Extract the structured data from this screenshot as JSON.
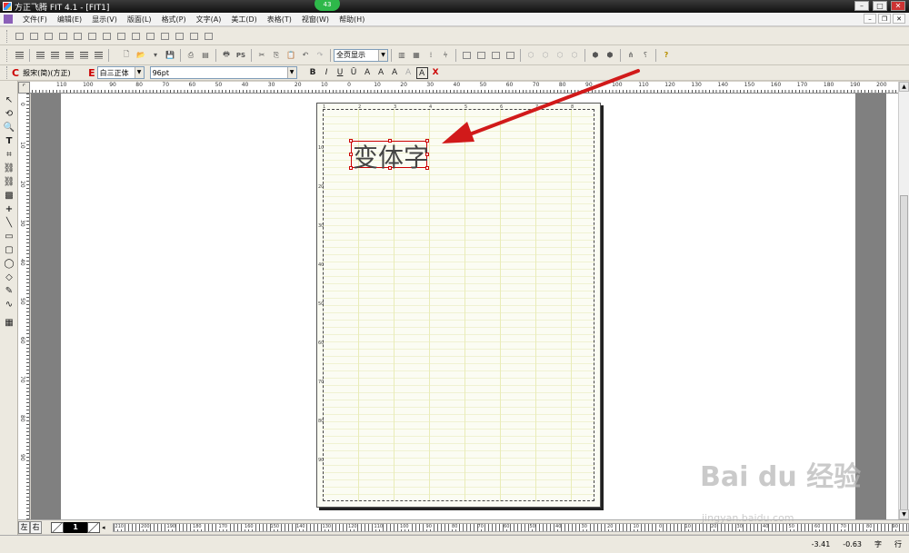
{
  "window": {
    "title": "方正飞腾 FIT 4.1 - [FIT1]",
    "badge": "43"
  },
  "menu": [
    "文件(F)",
    "编辑(E)",
    "显示(V)",
    "版面(L)",
    "格式(P)",
    "文字(A)",
    "美工(D)",
    "表格(T)",
    "视窗(W)",
    "帮助(H)"
  ],
  "toolbar": {
    "zoom_select": "全页显示",
    "font_c_label": "C",
    "font_c_value": "报宋(简)(方正)",
    "font_e_label": "E",
    "font_e_value": "白三正体",
    "font_size": "96pt",
    "fmt_buttons": [
      "B",
      "I",
      "U",
      "Ū",
      "A",
      "A",
      "A",
      "A",
      "A",
      "X"
    ]
  },
  "ruler": {
    "h_labels": [
      "110",
      "100",
      "90",
      "80",
      "70",
      "60",
      "50",
      "40",
      "30",
      "20",
      "10",
      "0",
      "10",
      "20",
      "30",
      "40",
      "50",
      "60",
      "70",
      "80",
      "90",
      "100",
      "110",
      "120",
      "130",
      "140",
      "150",
      "160",
      "170",
      "180",
      "190",
      "200"
    ],
    "v_labels": [
      "0",
      "10",
      "20",
      "30",
      "40",
      "50",
      "60",
      "70",
      "80",
      "90"
    ],
    "page_top": [
      "1",
      "2",
      "3",
      "4",
      "5",
      "6",
      "7",
      "8"
    ],
    "page_side": [
      "10",
      "20",
      "30",
      "40",
      "50",
      "60",
      "70",
      "80",
      "90"
    ],
    "bottom_labels": [
      "210",
      "200",
      "190",
      "180",
      "170",
      "160",
      "150",
      "140",
      "130",
      "120",
      "110",
      "100",
      "90",
      "80",
      "70",
      "60",
      "50",
      "40",
      "30",
      "20",
      "10",
      "0",
      "10",
      "20",
      "30",
      "40",
      "50",
      "60",
      "70",
      "80",
      "90"
    ]
  },
  "document": {
    "variant_text": "变体字"
  },
  "bottom": {
    "left": "左",
    "right": "右",
    "page": "1"
  },
  "status": {
    "x": "-3.41",
    "y": "-0.63",
    "mode1": "字",
    "mode2": "行"
  },
  "watermark": {
    "brand": "Bai du 经验",
    "url": "jingyan.baidu.com"
  },
  "colors": {
    "accent_red": "#d11a1a",
    "frame_red": "#cc0000",
    "gray_pasteboard": "#808080"
  }
}
